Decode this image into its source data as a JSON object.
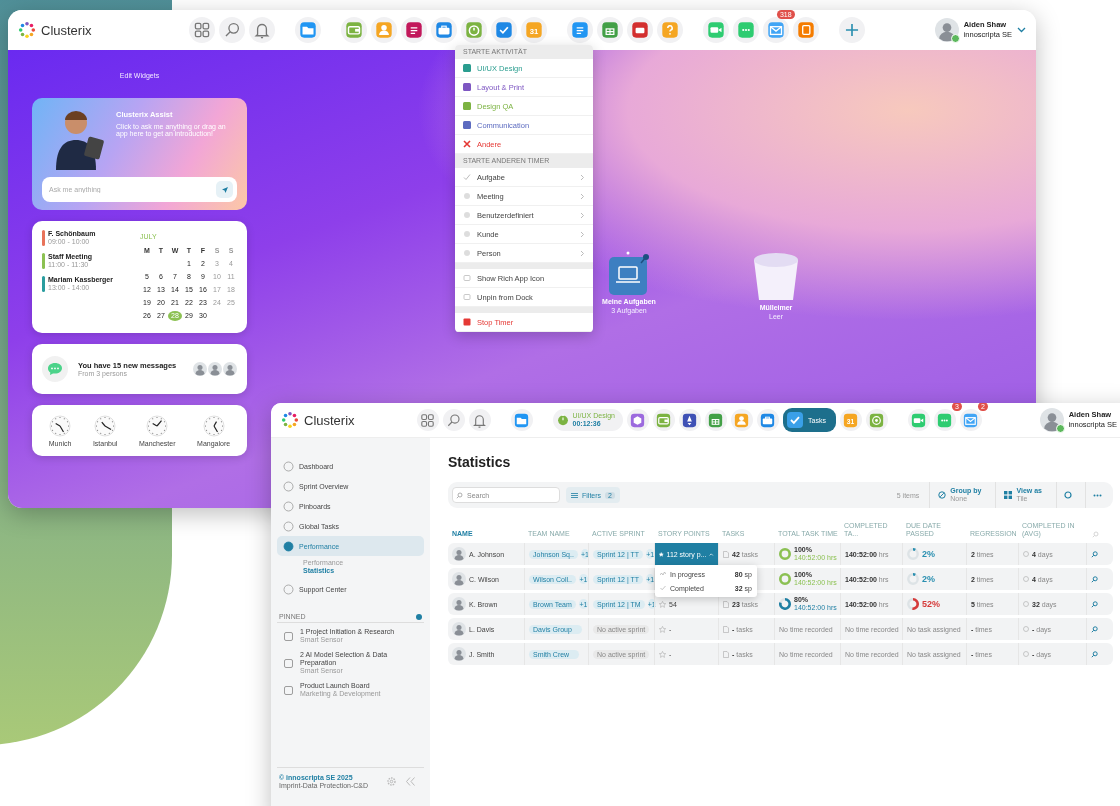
{
  "top_window": {
    "logo": "Clusterix",
    "calendar_icon_text": "31",
    "mail_badge": "318",
    "user": {
      "name": "Aiden Shaw",
      "company": "innoscripta SE",
      "online": true
    },
    "edit_widgets": "Edit Widgets",
    "assist": {
      "title": "Clusterix Assist",
      "text": "Click to ask me anything or drag an app here to get an introduction!",
      "placeholder": "Ask me anything"
    },
    "calendar": {
      "events": [
        {
          "title": "F. Schönbaum",
          "time": "09:00 - 10:00",
          "color": "#e8735a"
        },
        {
          "title": "Staff Meeting",
          "time": "11:00 - 11:30",
          "color": "#8cc152"
        },
        {
          "title": "Mariam Kassberger",
          "time": "13:00 - 14:00",
          "color": "#2a9d9f"
        }
      ],
      "month": "JULY",
      "weekdays": [
        "M",
        "T",
        "W",
        "T",
        "F",
        "S",
        "S"
      ],
      "weeks": [
        [
          {
            "n": "1",
            "selected": false
          },
          {
            "n": "2",
            "selected": false
          },
          {
            "n": "3",
            "selected": false
          },
          {
            "n": "4",
            "selected": false
          }
        ],
        [
          {
            "n": "5",
            "selected": false
          },
          {
            "n": "6",
            "selected": false
          },
          {
            "n": "7",
            "selected": false
          },
          {
            "n": "8",
            "selected": false
          },
          {
            "n": "9",
            "selected": false
          },
          {
            "n": "10",
            "selected": false
          },
          {
            "n": "11",
            "selected": false
          }
        ],
        [
          {
            "n": "12",
            "selected": false
          },
          {
            "n": "13",
            "selected": false
          },
          {
            "n": "14",
            "selected": false
          },
          {
            "n": "15",
            "selected": false
          },
          {
            "n": "16",
            "selected": false
          },
          {
            "n": "17",
            "selected": false
          },
          {
            "n": "18",
            "selected": false
          }
        ],
        [
          {
            "n": "19",
            "selected": false
          },
          {
            "n": "20",
            "selected": false
          },
          {
            "n": "21",
            "selected": false
          },
          {
            "n": "22",
            "selected": false
          },
          {
            "n": "23",
            "selected": false
          },
          {
            "n": "24",
            "selected": false
          },
          {
            "n": "25",
            "selected": false
          }
        ],
        [
          {
            "n": "26",
            "selected": false
          },
          {
            "n": "27",
            "selected": false
          },
          {
            "n": "28",
            "selected": true
          },
          {
            "n": "29",
            "selected": false
          },
          {
            "n": "30",
            "selected": false
          }
        ]
      ]
    },
    "messages": {
      "text": "You have 15 new messages",
      "sub": "From 3 persons"
    },
    "clocks": [
      "Munich",
      "Istanbul",
      "Manchester",
      "Mangalore"
    ],
    "context_menu": {
      "sections": [
        {
          "header": "STARTE AKTIVITÄT",
          "items": [
            {
              "kind": "activity",
              "label": "UI/UX Design",
              "color": "#2a9d8f"
            },
            {
              "kind": "activity",
              "label": "Layout & Print",
              "color": "#7e57c2"
            },
            {
              "kind": "activity",
              "label": "Design QA",
              "color": "#7cb342"
            },
            {
              "kind": "activity",
              "label": "Communication",
              "color": "#5c6bc0"
            },
            {
              "kind": "activity",
              "label": "Andere",
              "color": "#e53935"
            }
          ]
        },
        {
          "header": "STARTE ANDEREN TIMER",
          "items": [
            {
              "kind": "submenu",
              "label": "Aufgabe"
            },
            {
              "kind": "submenu",
              "label": "Meeting"
            },
            {
              "kind": "submenu",
              "label": "Benutzerdefiniert"
            },
            {
              "kind": "submenu",
              "label": "Kunde"
            },
            {
              "kind": "submenu",
              "label": "Person"
            }
          ]
        },
        {
          "items": [
            {
              "kind": "action",
              "label": "Show Rich App Icon"
            },
            {
              "kind": "action",
              "label": "Unpin from Dock"
            }
          ]
        },
        {
          "items": [
            {
              "kind": "stop",
              "label": "Stop Timer"
            }
          ]
        }
      ]
    },
    "desktop_icons": [
      {
        "kind": "tasks",
        "label": "Meine Aufgaben",
        "sub": "3 Aufgaben"
      },
      {
        "kind": "trash",
        "label": "Mülleimer",
        "sub": "Leer"
      }
    ]
  },
  "bottom_window": {
    "logo": "Clusterix",
    "timer": {
      "label": "UI/UX Design",
      "time": "00:12:36"
    },
    "active_app": "Tasks",
    "calendar_icon_text": "31",
    "chat_badge": "3",
    "mail_badge": "2",
    "user": {
      "name": "Aiden Shaw",
      "company": "innoscripta SE",
      "online": true
    },
    "sidebar": {
      "items": [
        {
          "label": "Dashboard",
          "selected": false
        },
        {
          "label": "Sprint Overview",
          "selected": false
        },
        {
          "label": "Pinboards",
          "selected": false
        },
        {
          "label": "Global Tasks",
          "selected": false
        },
        {
          "label": "Performance",
          "selected": true,
          "children": [
            {
              "label": "Performance",
              "selected": false
            },
            {
              "label": "Statistics",
              "selected": true
            }
          ]
        },
        {
          "label": "Support Center",
          "selected": false
        }
      ],
      "pinned_header": "PINNED",
      "pinned": [
        {
          "title": "1 Project Initiation & Research",
          "subtitle": "Smart Sensor"
        },
        {
          "title": "2 AI Model Selection & Data Preparation",
          "subtitle": "Smart Sensor"
        },
        {
          "title": "Product Launch Board",
          "subtitle": "Marketing & Development"
        }
      ],
      "copyright": "© innoscripta SE 2025",
      "legal": "Imprint-Data Protection-C&D"
    },
    "page_title": "Statistics",
    "toolbar": {
      "search_placeholder": "Search",
      "filters": "Filters",
      "filter_count": "2",
      "item_count": "5 items",
      "group_by": "Group by",
      "group_by_value": "None",
      "view_as": "View as",
      "view_as_value": "Tile"
    },
    "table": {
      "columns": [
        {
          "label": "NAME",
          "sorted": true
        },
        {
          "label": "TEAM NAME",
          "sorted": false
        },
        {
          "label": "ACTIVE SPRINT",
          "sorted": false
        },
        {
          "label": "STORY POINTS",
          "sorted": false
        },
        {
          "label": "TASKS",
          "sorted": false
        },
        {
          "label": "TOTAL TASK TIME",
          "sorted": false
        },
        {
          "label": "COMPLETED TA...",
          "sorted": false
        },
        {
          "label": "DUE DATE PASSED",
          "sorted": false
        },
        {
          "label": "REGRESSION",
          "sorted": false
        },
        {
          "label": "COMPLETED IN (AVG)",
          "sorted": false
        }
      ],
      "rows": [
        {
          "name": "A. Johnson",
          "team": "Johnson Sq..",
          "team_extra": "+1",
          "sprint": "Sprint 12 | TT",
          "sprint_extra": "+1",
          "has_sprint": true,
          "story_points": "112 story p...",
          "expanded": true,
          "breakdown": [
            {
              "label": "In progress",
              "value": "80",
              "unit": "sp"
            },
            {
              "label": "Completed",
              "value": "32",
              "unit": "sp"
            }
          ],
          "tasks": "**42** tasks",
          "total": {
            "percent": "100%",
            "hours": "140:52:00 hrs",
            "color": "#8cc152"
          },
          "completed": "**140:52:00** hrs",
          "due": {
            "percent": "2%",
            "color": "#2a8fb0"
          },
          "regression": "**2** times",
          "avg": "**4** days"
        },
        {
          "name": "C. Wilson",
          "team": "Wilson Coll..",
          "team_extra": "+1",
          "sprint": "Sprint 12 | TT",
          "sprint_extra": "+1",
          "has_sprint": true,
          "expanded": false,
          "total": {
            "percent": "100%",
            "hours": "140:52:00 hrs",
            "color": "#8cc152"
          },
          "completed": "**140:52:00** hrs",
          "due": {
            "percent": "2%",
            "color": "#2a8fb0"
          },
          "regression": "**2** times",
          "avg": "**4** days"
        },
        {
          "name": "K. Brown",
          "team": "Brown Team",
          "team_extra": "+1",
          "sprint": "Sprint 12 | TM",
          "sprint_extra": "+1",
          "has_sprint": true,
          "story_points": "54",
          "expanded": false,
          "tasks": "**23** tasks",
          "total": {
            "percent": "80%",
            "hours": "140:52:00 hrs",
            "color": "#1f7fa3"
          },
          "completed": "**140:52:00** hrs",
          "due": {
            "percent": "52%",
            "color": "#d63a3a"
          },
          "regression": "**5** times",
          "avg": "**32** days"
        },
        {
          "name": "L. Davis",
          "team": "Davis Group",
          "sprint": "No active sprint",
          "has_sprint": false,
          "story_points": "-",
          "expanded": false,
          "tasks": "**-** tasks",
          "total": {
            "text": "No time recorded"
          },
          "completed": "No time recorded",
          "due": {
            "text": "No task assigned"
          },
          "regression": "**-** times",
          "avg": "**-** days"
        },
        {
          "name": "J. Smith",
          "team": "Smith Crew",
          "sprint": "No active sprint",
          "has_sprint": false,
          "story_points": "-",
          "expanded": false,
          "tasks": "**-** tasks",
          "total": {
            "text": "No time recorded"
          },
          "completed": "No time recorded",
          "due": {
            "text": "No task assigned"
          },
          "regression": "**-** times",
          "avg": "**-** days"
        }
      ]
    }
  }
}
